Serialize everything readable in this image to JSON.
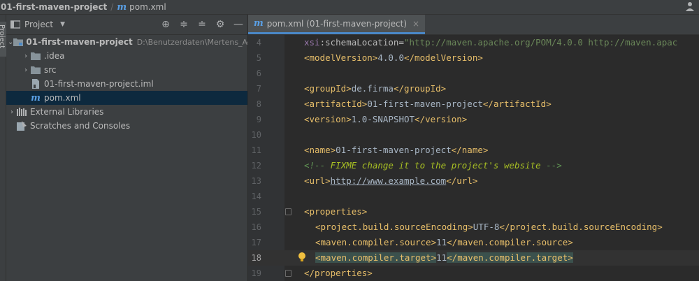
{
  "navbar": {
    "project": "01-first-maven-project",
    "file": "pom.xml",
    "file_icon_letter": "m",
    "user_icon": "user-icon"
  },
  "left_toolbar": {
    "tab_label": "Project"
  },
  "project_panel": {
    "title": "Project",
    "tools": [
      "target-icon",
      "expand-all-icon",
      "collapse-all-icon",
      "gear-icon",
      "minimize-icon"
    ],
    "tree": [
      {
        "label": "01-first-maven-project",
        "path": "D:\\Benutzerdaten\\Mertens_Achi",
        "icon": "module-folder-icon",
        "expanded": true,
        "level": 0
      },
      {
        "label": ".idea",
        "icon": "folder-icon",
        "expanded": false,
        "level": 1
      },
      {
        "label": "src",
        "icon": "folder-icon",
        "expanded": false,
        "level": 1
      },
      {
        "label": "01-first-maven-project.iml",
        "icon": "iml-file-icon",
        "level": 1
      },
      {
        "label": "pom.xml",
        "icon": "maven-icon",
        "level": 1,
        "selected": true
      },
      {
        "label": "External Libraries",
        "icon": "libraries-icon",
        "expanded": false,
        "level": 0
      },
      {
        "label": "Scratches and Consoles",
        "icon": "scratches-icon",
        "level": 0
      }
    ]
  },
  "editor": {
    "tab": {
      "label": "pom.xml (01-first-maven-project)",
      "close": "×"
    },
    "lines": [
      {
        "n": "4"
      },
      {
        "n": "5"
      },
      {
        "n": "6"
      },
      {
        "n": "7"
      },
      {
        "n": "8"
      },
      {
        "n": "9"
      },
      {
        "n": "10"
      },
      {
        "n": "11"
      },
      {
        "n": "12"
      },
      {
        "n": "13"
      },
      {
        "n": "14"
      },
      {
        "n": "15"
      },
      {
        "n": "16"
      },
      {
        "n": "17"
      },
      {
        "n": "18"
      },
      {
        "n": "19"
      }
    ],
    "code": {
      "l4_attr_ns": "xsi",
      "l4_attr": ":schemaLocation",
      "l4_eq": "=",
      "l4_val": "\"http://maven.apache.org/POM/4.0.0 http://maven.apac",
      "l5_open": "<modelVersion>",
      "l5_text": "4.0.0",
      "l5_close": "</modelVersion>",
      "l7_open": "<groupId>",
      "l7_text": "de.firma",
      "l7_close": "</groupId>",
      "l8_open": "<artifactId>",
      "l8_text": "01-first-maven-project",
      "l8_close": "</artifactId>",
      "l9_open": "<version>",
      "l9_text": "1.0-SNAPSHOT",
      "l9_close": "</version>",
      "l11_open": "<name>",
      "l11_text": "01-first-maven-project",
      "l11_close": "</name>",
      "l12_start": "<!-- ",
      "l12_fixme": "FIXME change it to the project's website",
      "l12_end": " -->",
      "l13_open": "<url>",
      "l13_text": "http://www.example.com",
      "l13_close": "</url>",
      "l15_open": "<properties>",
      "l16_open": "<project.build.sourceEncoding>",
      "l16_text": "UTF-8",
      "l16_close": "</project.build.sourceEncoding>",
      "l17_open": "<maven.compiler.source>",
      "l17_text": "11",
      "l17_close": "</maven.compiler.source>",
      "l18_open": "<maven.compiler.target>",
      "l18_text": "11",
      "l18_close": "</maven.compiler.target>",
      "l19_close": "</properties>"
    }
  }
}
